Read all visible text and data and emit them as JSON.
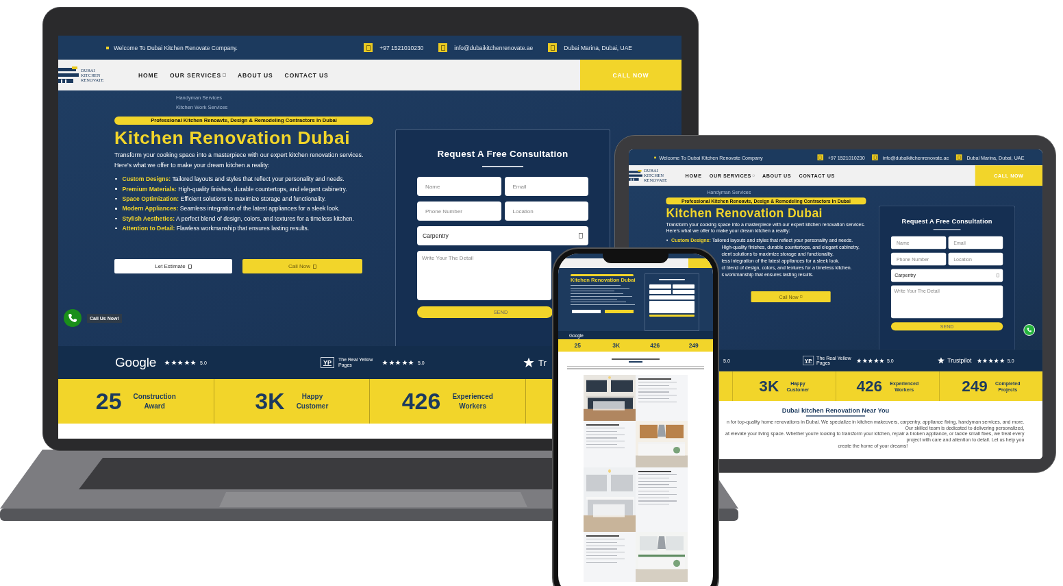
{
  "screens": [
    {
      "kind": "laptop",
      "topbar": {
        "welcome": "Welcome To Dubai Kitchen Renovate Company.",
        "phone": "+97 1521010230",
        "email": "info@dubaikitchenrenovate.ae",
        "location": "Dubai Marina, Dubai, UAE"
      },
      "logo": [
        "DUBAI",
        "KITCHEN",
        "RENOVATE"
      ],
      "nav": [
        {
          "label": "HOME",
          "has_menu": false
        },
        {
          "label": "OUR SERVICES",
          "has_menu": true
        },
        {
          "label": "ABOUT US",
          "has_menu": false
        },
        {
          "label": "CONTACT US",
          "has_menu": false
        }
      ],
      "call_button": "CALL NOW",
      "dropdown_items": [
        "Handyman Services",
        "Kitchen Work Services"
      ],
      "badge": "Professional Kitchen Renoavte, Design & Remodeling Contractors In Dubai",
      "title": "Kitchen Renovation Dubai",
      "intro": "Transform your cooking space into a masterpiece with our expert kitchen renovation services. Here's what we offer to make your dream kitchen a reality:",
      "bullets": [
        {
          "kind": "full",
          "label": "Custom Designs:",
          "text": "Tailored layouts and styles that reflect your personality and needs."
        },
        {
          "kind": "full",
          "label": "Premium Materials:",
          "text": "High-quality finishes, durable countertops, and elegant cabinetry."
        },
        {
          "kind": "full",
          "label": "Space Optimization:",
          "text": "Efficient solutions to maximize storage and functionality."
        },
        {
          "kind": "full",
          "label": "Modern Appliances:",
          "text": "Seamless integration of the latest appliances for a sleek look."
        },
        {
          "kind": "full",
          "label": "Stylish Aesthetics:",
          "text": "A perfect blend of design, colors, and textures for a timeless kitchen."
        },
        {
          "kind": "full",
          "label": "Attention to Detail:",
          "text": "Flawless workmanship that ensures lasting results."
        }
      ],
      "buttons": [
        {
          "kind": "outline",
          "label": "Let Estimate"
        },
        {
          "kind": "solid",
          "label": "Call Now"
        }
      ],
      "call_widget": "Call Us Now!",
      "form": {
        "title": "Request A Free Consultation",
        "fields": [
          {
            "kind": "input",
            "placeholder": "Name"
          },
          {
            "kind": "input",
            "placeholder": "Email"
          },
          {
            "kind": "input",
            "placeholder": "Phone Number"
          },
          {
            "kind": "input",
            "placeholder": "Location"
          },
          {
            "kind": "select",
            "value": "Carpentry"
          },
          {
            "kind": "textarea",
            "placeholder": "Write Your The Detail"
          }
        ],
        "submit": "SEND"
      },
      "reviews": [
        {
          "kind": "google",
          "name": "Google",
          "stars": 5,
          "score": "5.0"
        },
        {
          "kind": "yp",
          "badge": "YP",
          "name": "The Real Yellow Pages",
          "stars": 5,
          "score": "5.0"
        },
        {
          "kind": "trustpilot",
          "name": "Tr"
        }
      ],
      "stats": [
        {
          "value": "25",
          "label": "Construction Award"
        },
        {
          "value": "3K",
          "label": "Happy Customer"
        },
        {
          "value": "426",
          "label": "Experienced Workers"
        }
      ]
    },
    {
      "kind": "tablet",
      "topbar": {
        "welcome": "Welcome To Dubai Kitchen Renovate Company",
        "phone": "+97 1521010230",
        "email": "info@dubaikitchenrenovate.ae",
        "location": "Dubai Marina, Dubai, UAE"
      },
      "logo": [
        "DUBAI",
        "KITCHEN",
        "RENOVATE"
      ],
      "nav": [
        {
          "label": "HOME",
          "has_menu": false
        },
        {
          "label": "OUR SERVICES",
          "has_menu": true
        },
        {
          "label": "ABOUT US",
          "has_menu": false
        },
        {
          "label": "CONTACT US",
          "has_menu": false
        }
      ],
      "call_button": "CALL NOW",
      "dropdown_items": [
        "Handyman Services"
      ],
      "badge": "Professional Kitchen Renoavte, Design & Remodeling Contractors In Dubai",
      "title": "Kitchen Renovation Dubai",
      "intro": "Transform your cooking space into a masterpiece with our expert kitchen renovation services. Here's what we offer to make your dream kitchen a reality:",
      "bullets": [
        {
          "kind": "full",
          "label": "Custom Designs:",
          "text": "Tailored layouts and styles that reflect your personality and needs."
        },
        {
          "kind": "fragment",
          "text": "High-quality finishes, durable countertops, and elegant cabinetry."
        },
        {
          "kind": "fragment",
          "text": "cient solutions to maximize storage and functionality."
        },
        {
          "kind": "fragment",
          "text": "less integration of the latest appliances for a sleek look."
        },
        {
          "kind": "fragment",
          "text": "ct blend of design, colors, and textures for a timeless kitchen."
        },
        {
          "kind": "fragment",
          "text": "s workmanship that ensures lasting results."
        }
      ],
      "buttons": [
        {
          "kind": "solid",
          "label": "Call Now"
        }
      ],
      "whatsapp_button": true,
      "form": {
        "title": "Request A Free Consultation",
        "fields": [
          {
            "kind": "input",
            "placeholder": "Name"
          },
          {
            "kind": "input",
            "placeholder": "Email"
          },
          {
            "kind": "input",
            "placeholder": "Phone Number"
          },
          {
            "kind": "input",
            "placeholder": "Location"
          },
          {
            "kind": "select",
            "value": "Carpentry"
          },
          {
            "kind": "textarea",
            "placeholder": "Write Your The Detail"
          }
        ],
        "submit": "SEND"
      },
      "reviews": [
        {
          "kind": "rating",
          "score": "5.0"
        },
        {
          "kind": "yp",
          "badge": "YP",
          "name": "The Real Yellow Pages",
          "stars": 5,
          "score": "5.0"
        },
        {
          "kind": "trustpilot",
          "name": "Trustpilot",
          "stars": 5,
          "score": "5.0"
        }
      ],
      "stats": [
        {
          "value": "3K",
          "label": "Happy Customer"
        },
        {
          "value": "426",
          "label": "Experienced Workers"
        },
        {
          "value": "249",
          "label": "Completed Projects"
        }
      ],
      "near_you": {
        "title": "Dubai kitchen Renovation Near You",
        "lines": [
          "n for top-quality home renovations in Dubai. We specialize in kitchen makeovers, carpentry, appliance fixing, handyman services, and more. Our skilled team is dedicated to delivering personalized,",
          "at elevate your living space. Whether you're looking to transform your kitchen, repair a broken appliance, or tackle small fixes, we treat every project with care and attention to detail. Let us help you",
          "create the home of your dreams!"
        ]
      }
    }
  ],
  "phone": {
    "title": "Kitchen Renovation Dubai",
    "review": "Google",
    "stats": [
      "25",
      "3K",
      "426",
      "249"
    ]
  }
}
